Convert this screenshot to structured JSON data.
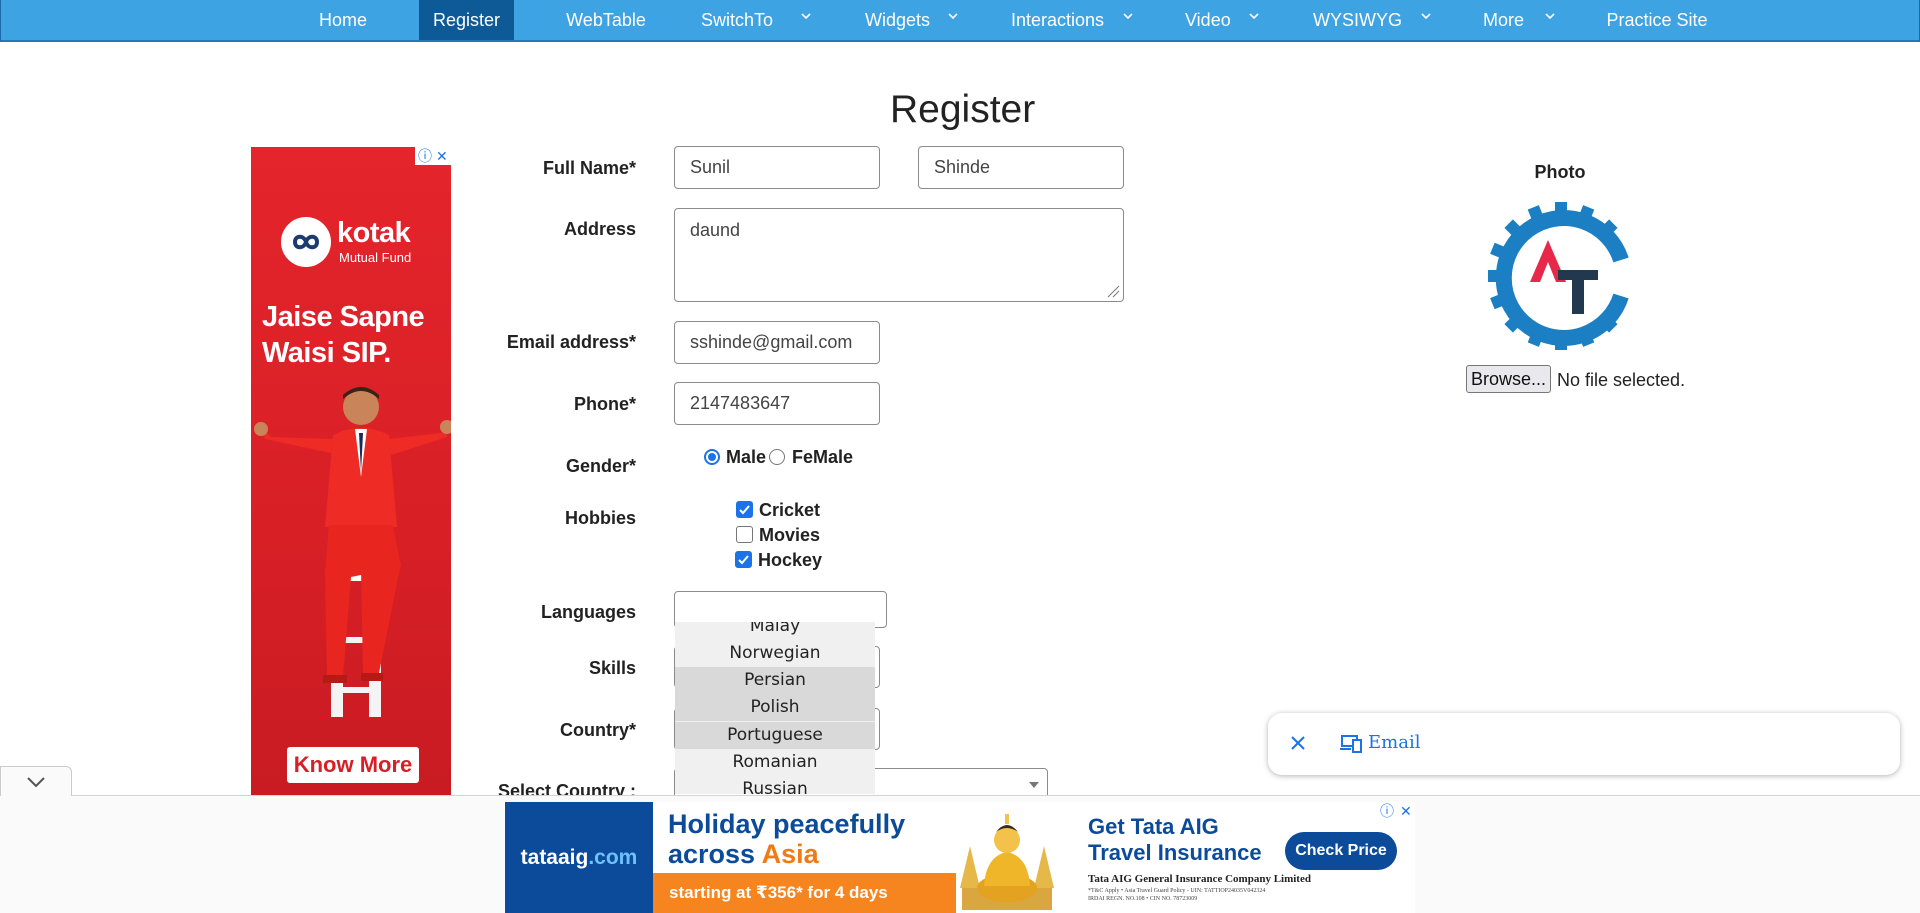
{
  "nav": {
    "items": [
      {
        "label": "Home"
      },
      {
        "label": "Register"
      },
      {
        "label": "WebTable"
      },
      {
        "label": "SwitchTo"
      },
      {
        "label": "Widgets"
      },
      {
        "label": "Interactions"
      },
      {
        "label": "Video"
      },
      {
        "label": "WYSIWYG"
      },
      {
        "label": "More"
      },
      {
        "label": "Practice Site"
      }
    ],
    "active": "Register"
  },
  "page_title": "Register",
  "left_ad": {
    "brand": "kotak",
    "brand_sub": "Mutual Fund",
    "tagline_line1": "Jaise Sapne",
    "tagline_line2": "Waisi SIP.",
    "cta": "Know More",
    "adchoices_icon": "info-icon",
    "close_icon": "close-icon",
    "brand_color": "#d81f26"
  },
  "form": {
    "full_name_label": "Full Name*",
    "first_name": "Sunil",
    "last_name": "Shinde",
    "address_label": "Address",
    "address": "daund",
    "email_label": "Email address*",
    "email": "sshinde@gmail.com",
    "phone_label": "Phone*",
    "phone": "2147483647",
    "gender_label": "Gender*",
    "gender_options": [
      {
        "label": "Male",
        "checked": true
      },
      {
        "label": "FeMale",
        "checked": false
      }
    ],
    "hobbies_label": "Hobbies",
    "hobbies": [
      {
        "label": "Cricket",
        "checked": true
      },
      {
        "label": "Movies",
        "checked": false
      },
      {
        "label": "Hockey",
        "checked": true
      }
    ],
    "languages_label": "Languages",
    "languages_value": "",
    "language_options": [
      "Malay",
      "Norwegian",
      "Persian",
      "Polish",
      "Portuguese",
      "Romanian",
      "Russian"
    ],
    "language_highlighted": [
      "Persian",
      "Polish",
      "Portuguese"
    ],
    "skills_label": "Skills",
    "country_label": "Country*",
    "select_country_label": "Select Country :"
  },
  "photo": {
    "label": "Photo",
    "browse": "Browse...",
    "status": "No file selected.",
    "logo_icon": "automation-testing-gear-logo",
    "logo_blue": "#1c7fc4",
    "logo_red": "#e8284b",
    "logo_dark": "#22384f"
  },
  "email_widget": {
    "label": "Email",
    "close_icon": "close-icon",
    "device_icon": "devices-icon"
  },
  "bottom_ad": {
    "brand_a": "tataaig",
    "brand_b": ".com",
    "headline_line1": "Holiday peacefully",
    "headline_line2_a": "across ",
    "headline_line2_b": "Asia",
    "strip": "starting at ₹356* for 4 days",
    "get_line1": "Get Tata AIG",
    "get_line2": "Travel Insurance",
    "company": "Tata AIG General Insurance Company Limited",
    "fine1": "*T&C Apply • Asia Travel Guard Policy - UIN: TATTIOP24035V042324",
    "fine2": "IRDAI REGN. NO.108 • CIN NO. 78723009",
    "cta": "Check Price",
    "accent": "#f7851f",
    "brand_color": "#0b4b9a"
  }
}
